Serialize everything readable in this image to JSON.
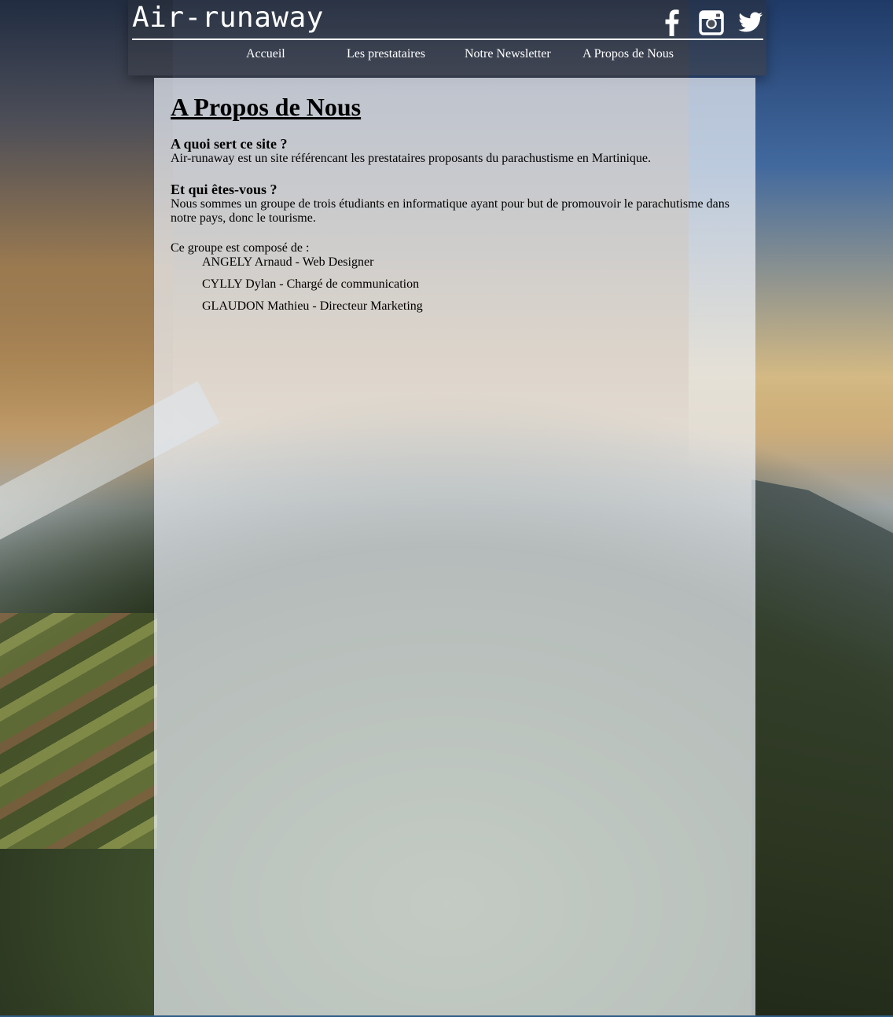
{
  "brand": "Air-runaway",
  "socials": [
    {
      "name": "facebook-icon"
    },
    {
      "name": "instagram-icon"
    },
    {
      "name": "twitter-icon"
    }
  ],
  "nav": {
    "home": "Accueil",
    "providers": "Les prestataires",
    "newsletter": "Notre Newsletter",
    "about": "A Propos de Nous"
  },
  "page": {
    "title": "A Propos de Nous",
    "q1": "A quoi sert ce site ?",
    "a1": "Air-runaway est un site référencant les prestataires proposants du parachustisme en Martinique.",
    "q2": "Et qui êtes-vous ?",
    "a2": "Nous sommes un groupe de trois étudiants en informatique ayant pour but de promouvoir le parachutisme dans notre pays, donc le tourisme.",
    "group_intro": "Ce groupe est composé de :",
    "members": [
      "ANGELY Arnaud - Web Designer",
      "CYLLY Dylan - Chargé de communication",
      "GLAUDON Mathieu - Directeur Marketing"
    ]
  },
  "colors": {
    "panel": "#ecf0f6",
    "header": "#3c404a",
    "text": "#000000",
    "nav_text": "#ffffff"
  }
}
